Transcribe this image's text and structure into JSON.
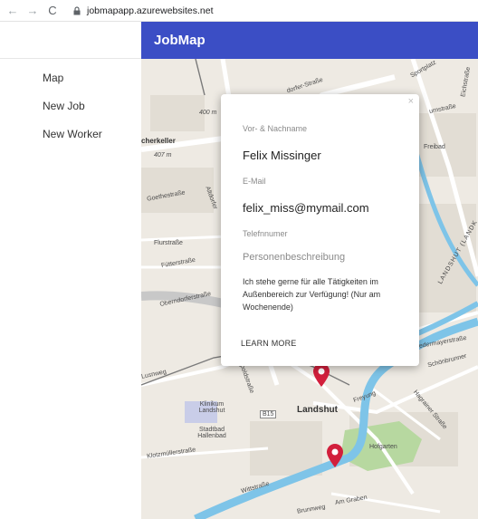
{
  "browser": {
    "back_icon": "←",
    "forward_icon": "→",
    "reload_icon": "C",
    "url": "jobmapapp.azurewebsites.net"
  },
  "sidebar": {
    "items": [
      {
        "label": "Map"
      },
      {
        "label": "New Job"
      },
      {
        "label": "New Worker"
      }
    ]
  },
  "header": {
    "title": "JobMap"
  },
  "map": {
    "labels": {
      "sportplatz": "Sportplatz",
      "dorferstrasse": "dorfer-Straße",
      "hofstrasse": "urnstraße",
      "eichstrasse": "Eichstraße",
      "kerkeller": "cherkeller",
      "elevation_407": "407 m",
      "elevation_400": "400 m",
      "freibad": "Freibad",
      "goethestrasse": "Goethestraße",
      "lilienstrasse": "Flurstraße",
      "fuetterer": "Fütterstraße",
      "oberndorfer": "Oberndorferstraße",
      "landshut_city": "Landshut",
      "hilfsgarten": "Hofgarten",
      "klinikum": "Klinikum Landshut",
      "stadtbad": "Stadtbad Hallenbad",
      "klotzmuller": "Klotzmüllerstraße",
      "wittstrasse": "Wittstraße",
      "am_graben": "Am Graben",
      "bruennlweg": "Brunnweg",
      "freyung": "Freyung",
      "hagrainer": "Hagrainer Straße",
      "lusnweg": "Lusnweg",
      "poldistrasse": "poldstraße",
      "b15": "B15",
      "altdorfer": "Altdorfer",
      "niedermayer": "Niedermayerstraße",
      "schonbrunner": "Schönbrunner",
      "landshut_landkreis": "LANDSHUT (LANDK"
    }
  },
  "popup": {
    "close_icon": "×",
    "name_label": "Vor- & Nachname",
    "name_value": "Felix Missinger",
    "email_label": "E-Mail",
    "email_value": "felix_miss@mymail.com",
    "phone_label": "Telefnnumer",
    "desc_label": "Personenbeschreibung",
    "desc_value": "Ich stehe gerne für alle Tätigkeiten im Außenbereich zur Verfügung! (Nur am Wochenende)",
    "action_label": "LEARN MORE"
  },
  "colors": {
    "header_bg": "#3b4ec5",
    "marker": "#d21f3c",
    "river": "#7ec4e8",
    "park": "#b7d8a0"
  }
}
